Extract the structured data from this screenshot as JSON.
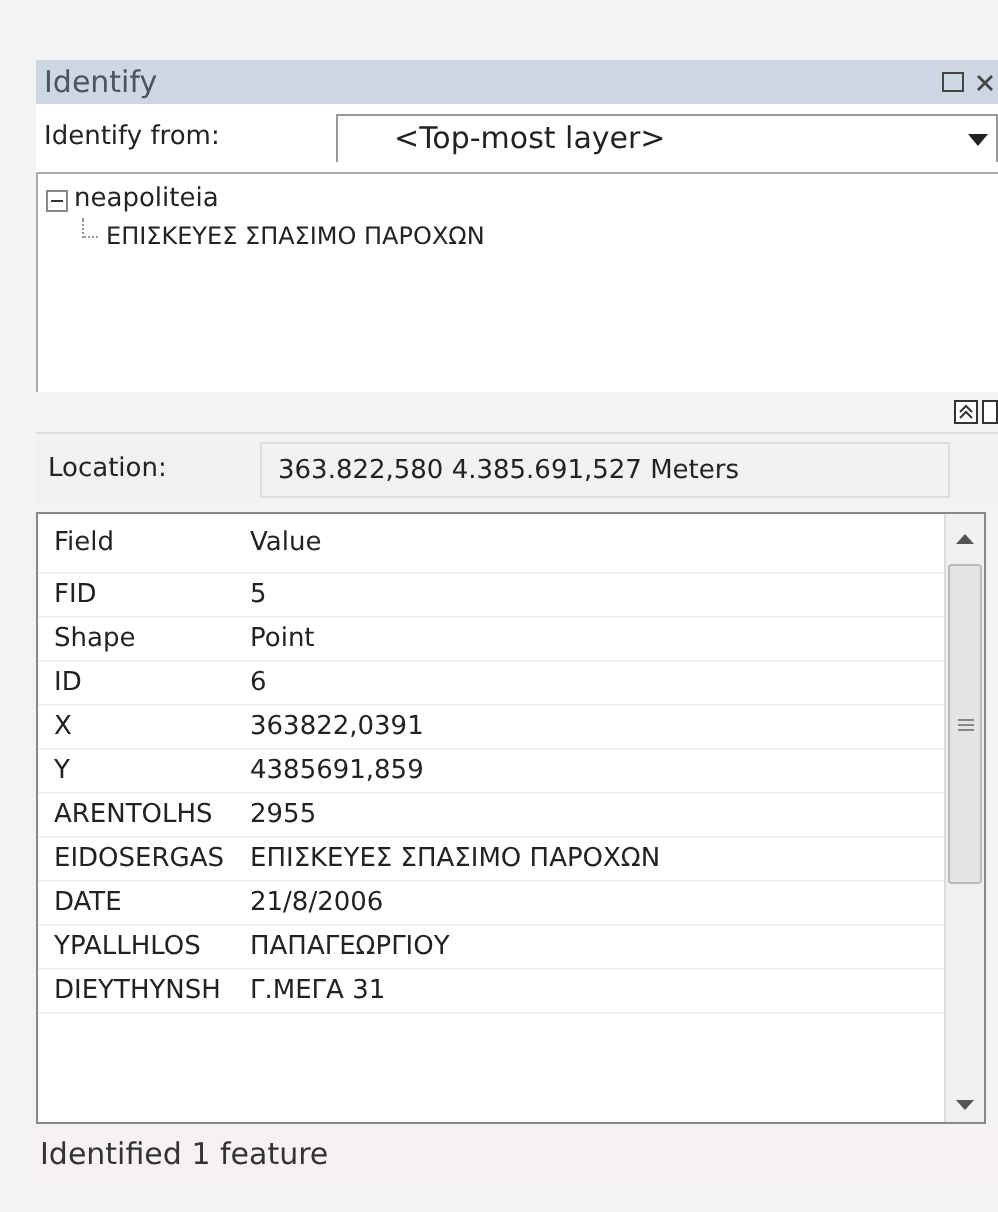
{
  "window": {
    "title": "Identify"
  },
  "identify_from": {
    "label": "Identify from:",
    "value": "<Top-most layer>"
  },
  "tree": [
    {
      "label": "neapoliteia",
      "expanded": true,
      "children": [
        {
          "label": "ΕΠΙΣΚΕΥΕΣ ΣΠΑΣΙΜΟ ΠΑΡΟΧΩΝ"
        }
      ]
    }
  ],
  "location": {
    "label": "Location:",
    "value": "363.822,580  4.385.691,527 Meters"
  },
  "table": {
    "columns": [
      "Field",
      "Value"
    ],
    "rows": [
      [
        "FID",
        "5"
      ],
      [
        "Shape",
        "Point"
      ],
      [
        "ID",
        "6"
      ],
      [
        "X",
        "363822,0391"
      ],
      [
        "Y",
        "4385691,859"
      ],
      [
        "ARENTOLHS",
        "2955"
      ],
      [
        "EIDOSERGAS",
        "ΕΠΙΣΚΕΥΕΣ ΣΠΑΣΙΜΟ ΠΑΡΟΧΩΝ"
      ],
      [
        "DATE",
        "21/8/2006"
      ],
      [
        "YPALLHLOS",
        "ΠΑΠΑΓΕΩΡΓΙΟΥ"
      ],
      [
        "DIEYTHYNSH",
        "Γ.ΜΕΓΑ 31"
      ]
    ]
  },
  "status_bar": "Identified 1 feature"
}
